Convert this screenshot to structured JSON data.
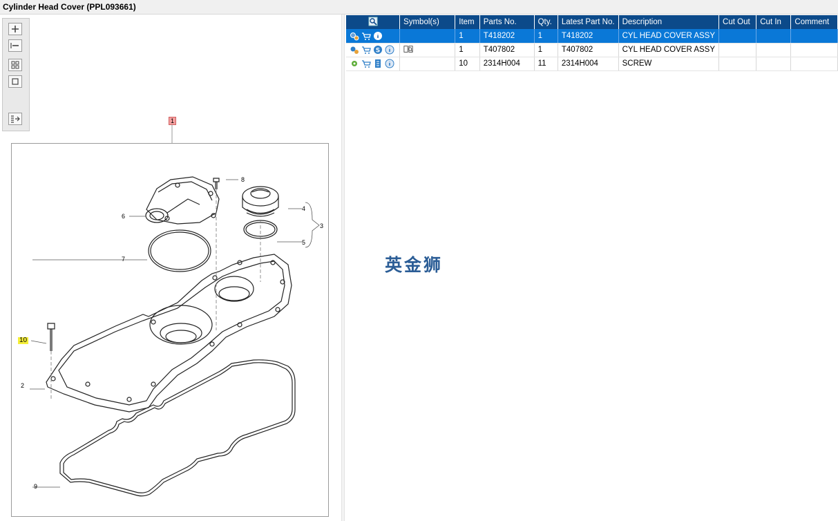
{
  "window": {
    "title": "Cylinder Head Cover (PPL093661)"
  },
  "toolbar": {
    "buttons": [
      "zoom-in",
      "zoom-out",
      "fit-all",
      "actual-size",
      "export"
    ]
  },
  "drawing": {
    "callouts": {
      "sheet": "1",
      "c2": "2",
      "c3": "3",
      "c4": "4",
      "c5": "5",
      "c6": "6",
      "c7": "7",
      "c8": "8",
      "c9": "9",
      "c10": "10"
    }
  },
  "table": {
    "headers": {
      "symbols": "Symbol(s)",
      "item": "Item",
      "parts_no": "Parts No.",
      "qty": "Qty.",
      "latest": "Latest Part No.",
      "desc": "Description",
      "cut_out": "Cut Out",
      "cut_in": "Cut In",
      "comment": "Comment"
    },
    "rows": [
      {
        "item": "1",
        "parts_no": "T418202",
        "qty": "1",
        "latest": "T418202",
        "desc": "CYL HEAD COVER ASSY",
        "cut_out": "",
        "cut_in": "",
        "comment": ""
      },
      {
        "item": "1",
        "parts_no": "T407802",
        "qty": "1",
        "latest": "T407802",
        "desc": "CYL HEAD COVER ASSY",
        "cut_out": "",
        "cut_in": "",
        "comment": ""
      },
      {
        "item": "10",
        "parts_no": "2314H004",
        "qty": "11",
        "latest": "2314H004",
        "desc": "SCREW",
        "cut_out": "",
        "cut_in": "",
        "comment": ""
      }
    ]
  },
  "watermark": {
    "text": "英金狮"
  },
  "colors": {
    "header": "#0c4a8a",
    "selected_row": "#0a78d7",
    "watermark": "#2b5d96"
  }
}
